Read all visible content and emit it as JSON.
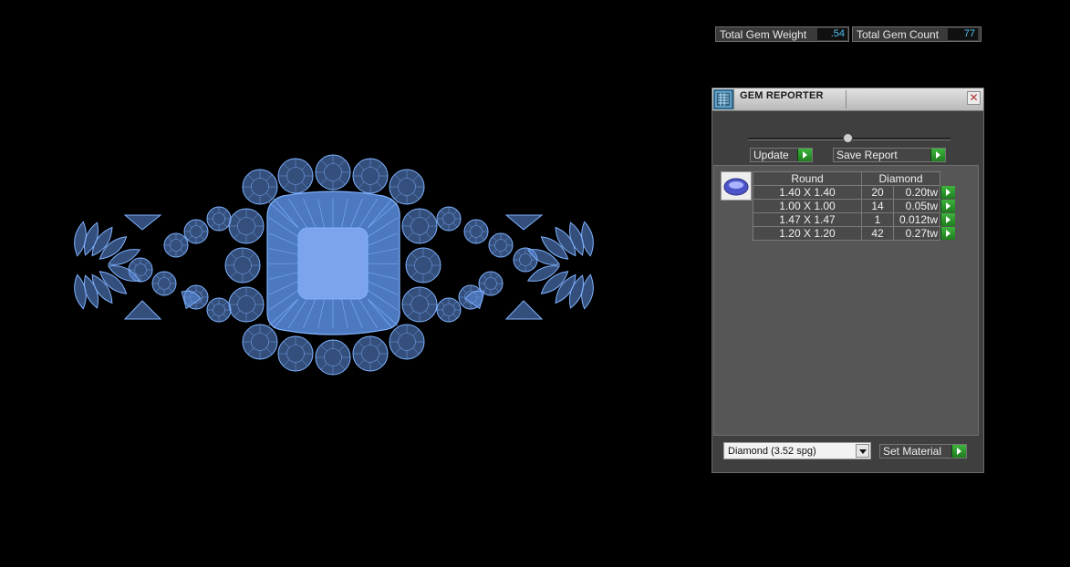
{
  "panel": {
    "title": "GEM REPORTER",
    "total_weight_label": "Total Gem Weight",
    "total_weight_value": ".54",
    "total_count_label": "Total Gem Count",
    "total_count_value": "77",
    "update_label": "Update",
    "save_report_label": "Save Report",
    "table": {
      "headers": [
        "Round",
        "Diamond"
      ],
      "rows": [
        {
          "size": "1.40 X 1.40",
          "count": "20",
          "weight": "0.20tw"
        },
        {
          "size": "1.00 X 1.00",
          "count": "14",
          "weight": "0.05tw"
        },
        {
          "size": "1.47 X 1.47",
          "count": "1",
          "weight": "0.012tw"
        },
        {
          "size": "1.20 X 1.20",
          "count": "42",
          "weight": "0.27tw"
        }
      ]
    },
    "material_select_value": "Diamond    (3.52 spg)",
    "set_material_label": "Set Material"
  },
  "colors": {
    "wireframe": "#7fb2ff",
    "wireframe_fill": "#5e8fe0",
    "value_text": "#4fc3f7",
    "go_button": "#2a9a2a"
  },
  "icons": {
    "close": "close-icon",
    "go": "play-arrow-icon",
    "app": "gem-reporter-icon",
    "thumb": "round-gem-icon",
    "dropdown": "chevron-down-icon"
  }
}
